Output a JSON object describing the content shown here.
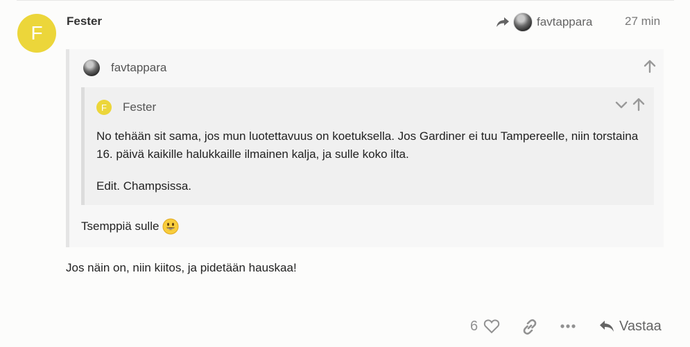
{
  "post": {
    "author": "Fester",
    "author_initial": "F",
    "reply_to_user": "favtappara",
    "time": "27 min",
    "body": "Jos näin on, niin kiitos, ja pidetään hauskaa!"
  },
  "quote_outer": {
    "author": "favtappara",
    "text": "Tsemppiä sulle"
  },
  "quote_inner": {
    "author": "Fester",
    "author_initial": "F",
    "paragraph_1": "No tehään sit sama, jos mun luotettavuus on koetuksella. Jos Gardiner ei tuu Tampereelle, niin torstaina 16. päivä kaikille halukkaille ilmainen kalja, ja sulle koko ilta.",
    "paragraph_2": "Edit. Champsissa."
  },
  "actions": {
    "like_count": "6",
    "reply_label": "Vastaa"
  },
  "colors": {
    "avatar_yellow": "#ecd63a",
    "icon_gray": "#919191"
  }
}
